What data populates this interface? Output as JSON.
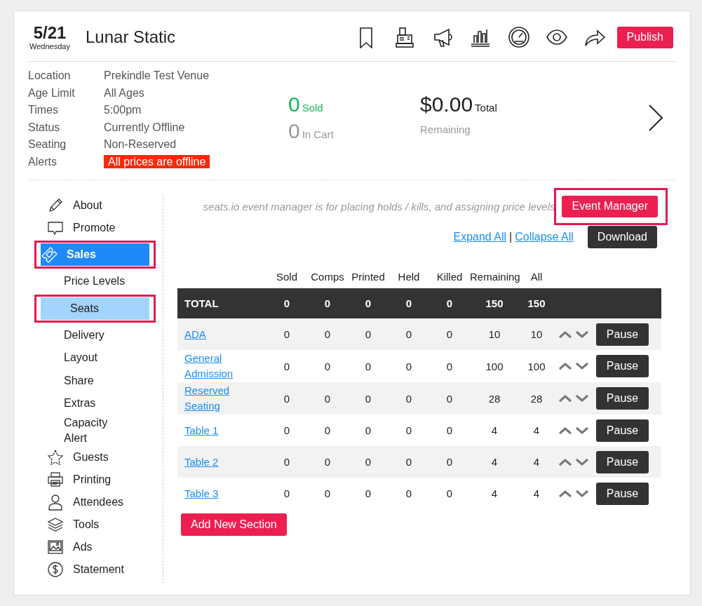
{
  "event": {
    "date": "5/21",
    "weekday": "Wednesday",
    "title": "Lunar Static"
  },
  "publish_button": "Publish",
  "details": [
    {
      "label": "Location",
      "value": "Prekindle Test Venue",
      "kind": "text"
    },
    {
      "label": "Age Limit",
      "value": "All Ages",
      "kind": "text"
    },
    {
      "label": "Times",
      "value": "5:00pm",
      "kind": "text"
    },
    {
      "label": "Status",
      "value": "Currently Offline",
      "kind": "text"
    },
    {
      "label": "Seating",
      "value": "Non-Reserved",
      "kind": "text"
    },
    {
      "label": "Alerts",
      "value": "All prices are offline",
      "kind": "alert"
    }
  ],
  "stats": {
    "sold": {
      "count": "0",
      "label": "Sold"
    },
    "in_cart": {
      "count": "0",
      "label": "In Cart"
    },
    "total": {
      "amount": "$0.00",
      "label": "Total"
    },
    "remaining": "Remaining"
  },
  "sidebar": {
    "items": [
      {
        "label": "About",
        "selected": false,
        "highlighted": false
      },
      {
        "label": "Promote",
        "selected": false,
        "highlighted": false
      },
      {
        "label": "Sales",
        "selected": true,
        "highlighted": true,
        "children": [
          {
            "label": "Price Levels",
            "selected": false,
            "highlighted": false
          },
          {
            "label": "Seats",
            "selected": true,
            "highlighted": true
          },
          {
            "label": "Delivery",
            "selected": false,
            "highlighted": false
          },
          {
            "label": "Layout",
            "selected": false,
            "highlighted": false
          },
          {
            "label": "Share",
            "selected": false,
            "highlighted": false
          },
          {
            "label": "Extras",
            "selected": false,
            "highlighted": false
          },
          {
            "label": "Capacity Alert",
            "selected": false,
            "highlighted": false
          }
        ]
      },
      {
        "label": "Guests",
        "selected": false,
        "highlighted": false
      },
      {
        "label": "Printing",
        "selected": false,
        "highlighted": false
      },
      {
        "label": "Attendees",
        "selected": false,
        "highlighted": false
      },
      {
        "label": "Tools",
        "selected": false,
        "highlighted": false
      },
      {
        "label": "Ads",
        "selected": false,
        "highlighted": false
      },
      {
        "label": "Statement",
        "selected": false,
        "highlighted": false
      }
    ]
  },
  "note": "seats.io event manager is for placing holds / kills, and assigning price levels",
  "event_manager_button": {
    "label": "Event Manager",
    "highlighted": true
  },
  "links": {
    "expand": "Expand All",
    "separator": "|",
    "collapse": "Collapse All"
  },
  "download_button": "Download",
  "table": {
    "columns": [
      "Sold",
      "Comps",
      "Printed",
      "Held",
      "Killed",
      "Remaining",
      "All"
    ],
    "total": {
      "label": "TOTAL",
      "values": [
        "0",
        "0",
        "0",
        "0",
        "0",
        "150",
        "150"
      ]
    },
    "rows": [
      {
        "name": "ADA",
        "values": [
          "0",
          "0",
          "0",
          "0",
          "0",
          "10",
          "10"
        ],
        "action": "Pause"
      },
      {
        "name": "General Admission",
        "values": [
          "0",
          "0",
          "0",
          "0",
          "0",
          "100",
          "100"
        ],
        "action": "Pause"
      },
      {
        "name": "Reserved Seating",
        "values": [
          "0",
          "0",
          "0",
          "0",
          "0",
          "28",
          "28"
        ],
        "action": "Pause"
      },
      {
        "name": "Table 1",
        "values": [
          "0",
          "0",
          "0",
          "0",
          "0",
          "4",
          "4"
        ],
        "action": "Pause"
      },
      {
        "name": "Table 2",
        "values": [
          "0",
          "0",
          "0",
          "0",
          "0",
          "4",
          "4"
        ],
        "action": "Pause"
      },
      {
        "name": "Table 3",
        "values": [
          "0",
          "0",
          "0",
          "0",
          "0",
          "4",
          "4"
        ],
        "action": "Pause"
      }
    ]
  },
  "add_section_button": "Add New Section"
}
